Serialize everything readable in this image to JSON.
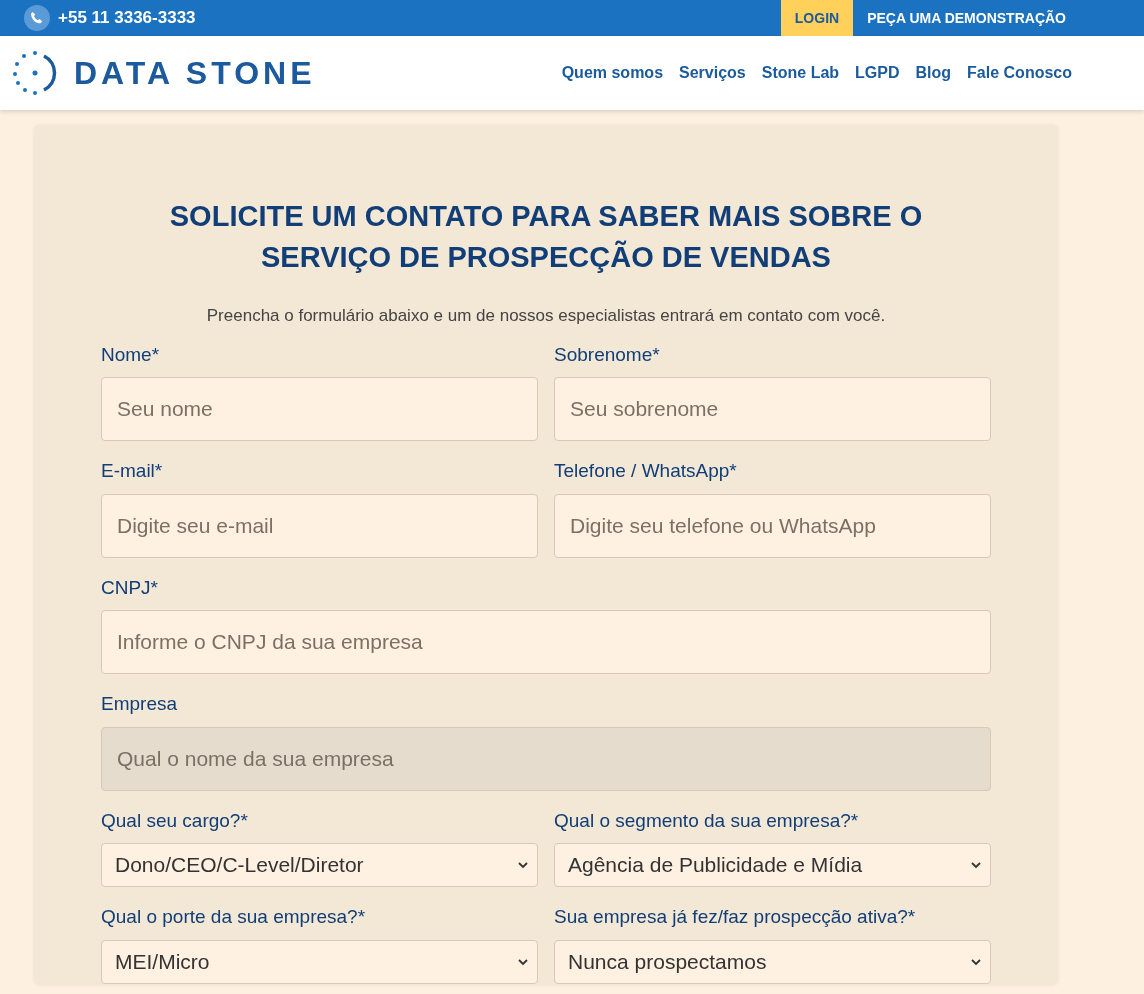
{
  "top_bar": {
    "phone": "+55 11 3336-3333",
    "login": "LOGIN",
    "demo": "PEÇA UMA DEMONSTRAÇÃO"
  },
  "header": {
    "logo_text": "DATA STONE",
    "nav": [
      {
        "label": "Quem somos"
      },
      {
        "label": "Serviços"
      },
      {
        "label": "Stone Lab"
      },
      {
        "label": "LGPD"
      },
      {
        "label": "Blog"
      },
      {
        "label": "Fale Conosco"
      }
    ]
  },
  "form": {
    "title": "SOLICITE UM CONTATO PARA SABER MAIS SOBRE O SERVIÇO DE PROSPECÇÃO DE VENDAS",
    "subtitle": "Preencha o formulário abaixo e um de nossos especialistas entrará em contato com você.",
    "rows": [
      [
        {
          "kind": "text",
          "label": "Nome*",
          "placeholder": "Seu nome",
          "disabled": false
        },
        {
          "kind": "text",
          "label": "Sobrenome*",
          "placeholder": "Seu sobrenome",
          "disabled": false
        }
      ],
      [
        {
          "kind": "text",
          "label": "E-mail*",
          "placeholder": "Digite seu e-mail",
          "disabled": false
        },
        {
          "kind": "text",
          "label": "Telefone / WhatsApp*",
          "placeholder": "Digite seu telefone ou WhatsApp",
          "disabled": false
        }
      ],
      [
        {
          "kind": "text",
          "label": "CNPJ*",
          "placeholder": "Informe o CNPJ da sua empresa",
          "disabled": false
        }
      ],
      [
        {
          "kind": "text",
          "label": "Empresa",
          "placeholder": "Qual o nome da sua empresa",
          "disabled": true
        }
      ],
      [
        {
          "kind": "select",
          "label": "Qual seu cargo?*",
          "value": "Dono/CEO/C-Level/Diretor"
        },
        {
          "kind": "select",
          "label": "Qual o segmento da sua empresa?*",
          "value": "Agência de Publicidade e Mídia"
        }
      ],
      [
        {
          "kind": "select",
          "label": "Qual o porte da sua empresa?*",
          "value": "MEI/Micro"
        },
        {
          "kind": "select",
          "label": "Sua empresa já fez/faz prospecção ativa?*",
          "value": "Nunca prospectamos"
        }
      ]
    ]
  }
}
